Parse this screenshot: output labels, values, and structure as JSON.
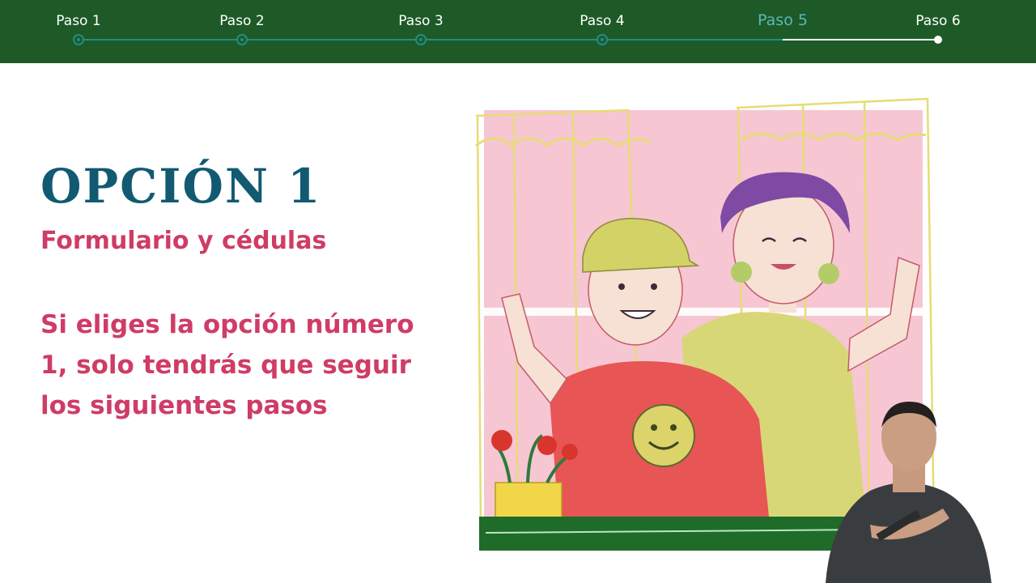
{
  "progress": {
    "steps": [
      {
        "label": "Paso 1"
      },
      {
        "label": "Paso 2"
      },
      {
        "label": "Paso 3"
      },
      {
        "label": "Paso 4"
      },
      {
        "label": "Paso 5"
      },
      {
        "label": "Paso 6"
      }
    ],
    "current_step": 5,
    "colors": {
      "bar": "#1e5a27",
      "done": "#1f8d8a",
      "remaining": "#ffffff",
      "current_label": "#5ab7b8"
    }
  },
  "content": {
    "heading": "OPCIÓN 1",
    "subheading": "Formulario y cédulas",
    "body": "Si eliges la opción número 1, solo tendrás que seguir los siguientes pasos",
    "colors": {
      "heading": "#115a72",
      "accent": "#cf3c66"
    }
  },
  "illustration": {
    "subject": "two people waving from a window",
    "icons": [
      "smiley-face-icon",
      "flower-pot-icon"
    ]
  },
  "interpreter": {
    "subject": "sign language interpreter"
  }
}
